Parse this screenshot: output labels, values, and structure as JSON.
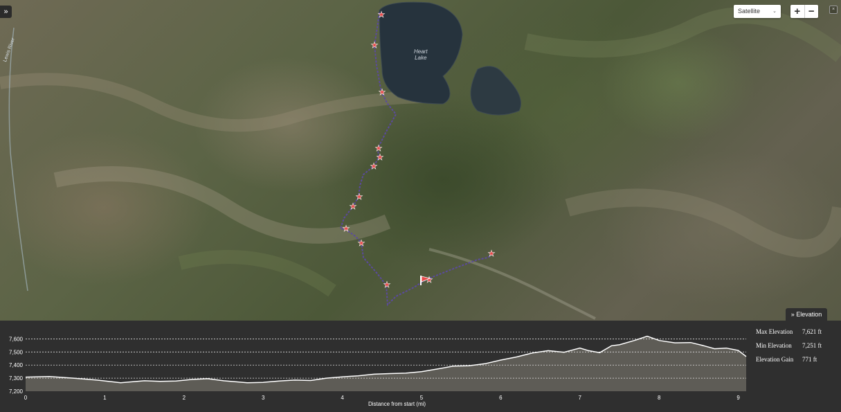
{
  "map": {
    "lake_label_line1": "Heart",
    "lake_label_line2": "Lake",
    "river_label": "Lewis River",
    "collapse_glyph": "»",
    "map_type": {
      "selected": "Satellite"
    },
    "zoom_in_label": "+",
    "zoom_out_label": "−",
    "close_glyph": "×",
    "route_color": "#5b4a9e",
    "marker_color": "#e84a4a"
  },
  "elevation": {
    "tab_label": "Elevation",
    "tab_icon": "double-chevron-down-icon",
    "stats": [
      {
        "label": "Max Elevation",
        "value": "7,621 ft"
      },
      {
        "label": "Min Elevation",
        "value": "7,251 ft"
      },
      {
        "label": "Elevation Gain",
        "value": "771 ft"
      }
    ]
  },
  "chart_data": {
    "type": "area",
    "xlabel": "Distance from start (mi)",
    "ylabel": "",
    "title": "",
    "xlim": [
      0,
      9.1
    ],
    "ylim": [
      7200,
      7650
    ],
    "x_ticks": [
      "0",
      "1",
      "2",
      "3",
      "4",
      "5",
      "6",
      "7",
      "8",
      "9"
    ],
    "y_ticks": [
      "7,600",
      "7,500",
      "7,400",
      "7,300",
      "7,200"
    ],
    "y_tick_values": [
      7600,
      7500,
      7400,
      7300,
      7200
    ],
    "grid": "horizontal dotted",
    "x": [
      0,
      0.3,
      0.6,
      0.9,
      1.2,
      1.5,
      1.7,
      1.9,
      2.1,
      2.3,
      2.5,
      2.8,
      3.0,
      3.2,
      3.4,
      3.6,
      3.8,
      4.0,
      4.2,
      4.4,
      4.6,
      4.8,
      5.0,
      5.2,
      5.4,
      5.6,
      5.8,
      6.0,
      6.2,
      6.4,
      6.6,
      6.8,
      7.0,
      7.1,
      7.25,
      7.4,
      7.5,
      7.7,
      7.85,
      8.0,
      8.2,
      8.4,
      8.55,
      8.7,
      8.85,
      9.0,
      9.1
    ],
    "values": [
      7308,
      7312,
      7300,
      7285,
      7265,
      7280,
      7275,
      7278,
      7290,
      7296,
      7280,
      7265,
      7268,
      7278,
      7285,
      7282,
      7300,
      7310,
      7318,
      7330,
      7335,
      7338,
      7350,
      7370,
      7392,
      7395,
      7410,
      7438,
      7462,
      7492,
      7510,
      7498,
      7530,
      7512,
      7495,
      7548,
      7555,
      7590,
      7621,
      7588,
      7570,
      7572,
      7550,
      7525,
      7530,
      7512,
      7465
    ]
  }
}
